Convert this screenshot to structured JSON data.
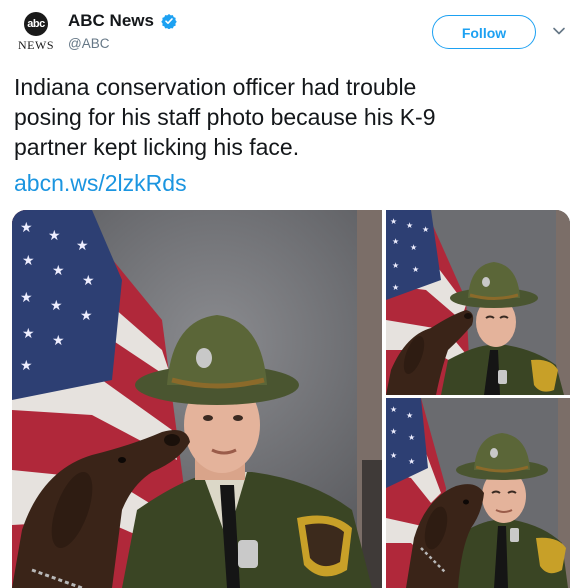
{
  "tweet": {
    "account_name": "ABC News",
    "handle": "@ABC",
    "logo_text": "abc",
    "logo_subtext": "NEWS",
    "follow_label": "Follow",
    "text_lines": [
      "Indiana conservation officer had trouble",
      "posing for his staff photo because his K-9",
      "partner kept licking his face."
    ],
    "link": "abcn.ws/2lzkRds"
  },
  "icons": {
    "verified": "verified-badge-icon",
    "menu": "chevron-down-icon"
  },
  "colors": {
    "accent": "#1da1f2",
    "link": "#1b95e0",
    "secondary_text": "#657786"
  }
}
